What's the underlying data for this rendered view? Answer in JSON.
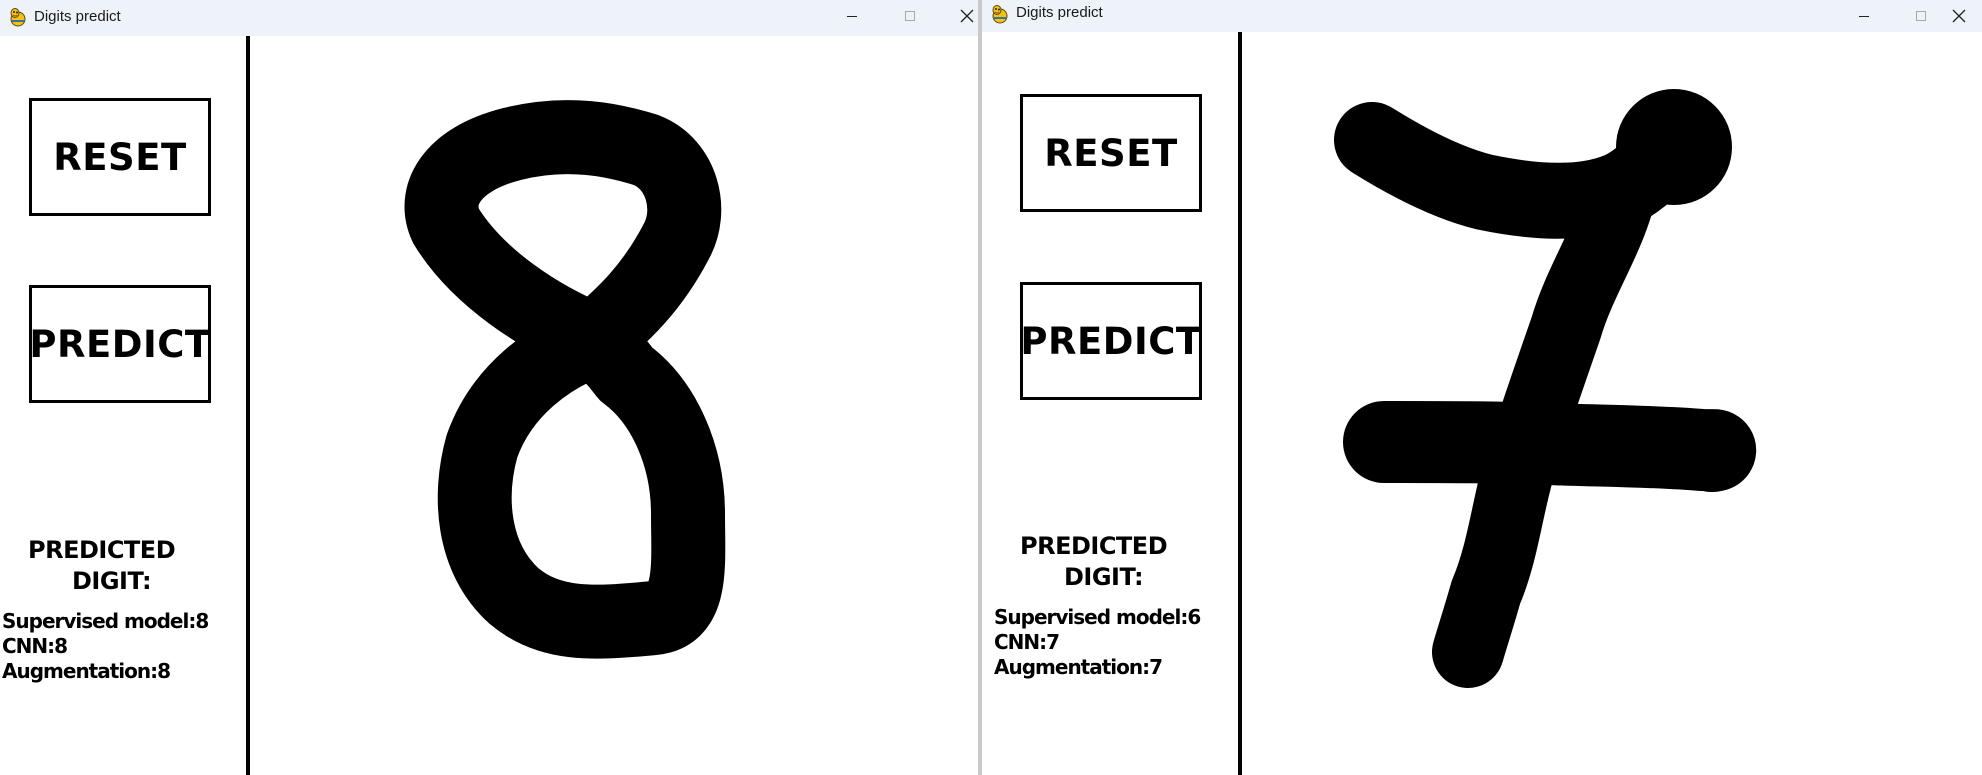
{
  "windows": [
    {
      "title": "Digits predict",
      "buttons": {
        "reset_label": "RESET",
        "predict_label": "PREDICT"
      },
      "predicted": {
        "heading_line1": "PREDICTED",
        "heading_line2": "DIGIT:",
        "supervised": "Supervised model:8",
        "cnn": "CNN:8",
        "augmentation": "Augmentation:8"
      },
      "drawn_digit": "8"
    },
    {
      "title": "Digits predict",
      "buttons": {
        "reset_label": "RESET",
        "predict_label": "PREDICT"
      },
      "predicted": {
        "heading_line1": "PREDICTED",
        "heading_line2": "DIGIT:",
        "supervised": "Supervised model:6",
        "cnn": "CNN:7",
        "augmentation": "Augmentation:7"
      },
      "drawn_digit": "7"
    }
  ],
  "icons": {
    "app": "pygame-snake-icon",
    "minimize": "minimize-icon",
    "maximize": "maximize-icon",
    "close": "close-icon"
  },
  "colors": {
    "titlebar": "#eef2f9",
    "ink": "#000000",
    "background": "#ffffff",
    "seam": "#c9c9c9"
  }
}
